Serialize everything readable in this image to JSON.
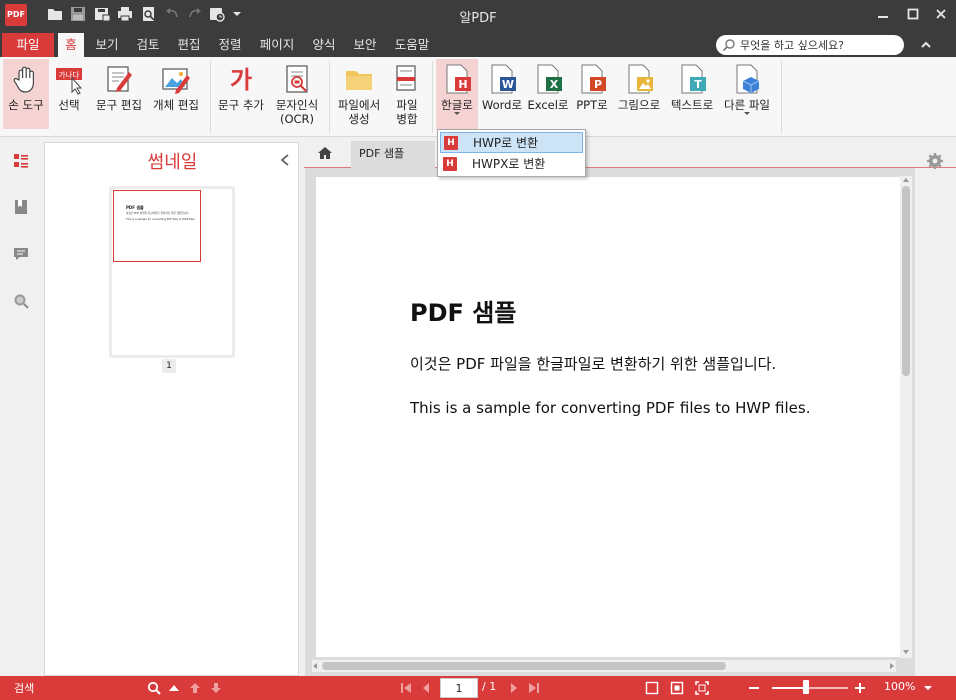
{
  "app": {
    "logo_text": "PDF",
    "title": "알PDF"
  },
  "menu": {
    "tabs": [
      {
        "label": "파일"
      },
      {
        "label": "홈"
      },
      {
        "label": "보기"
      },
      {
        "label": "검토"
      },
      {
        "label": "편집"
      },
      {
        "label": "정렬"
      },
      {
        "label": "페이지"
      },
      {
        "label": "양식"
      },
      {
        "label": "보안"
      },
      {
        "label": "도움말"
      }
    ],
    "active_tab": "홈"
  },
  "search": {
    "placeholder": "무엇을 하고 싶으세요?"
  },
  "ribbon": {
    "hand_tool": "손 도구",
    "select": "선택",
    "select_badge": "가나다",
    "text_edit": "문구 편집",
    "object_edit": "개체 편집",
    "add_text": "문구 추가",
    "add_text_glyph": "가",
    "ocr_line1": "문자인식",
    "ocr_line2": "(OCR)",
    "create_line1": "파일에서",
    "create_line2": "생성",
    "merge_line1": "파일",
    "merge_line2": "병합",
    "to_hangul": "한글로",
    "to_word": "Word로",
    "to_excel": "Excel로",
    "to_ppt": "PPT로",
    "to_image": "그림으로",
    "to_text": "텍스트로",
    "other_file": "다른 파일",
    "badge_h": "H",
    "badge_w": "W",
    "badge_x": "X",
    "badge_p": "P",
    "badge_t": "T"
  },
  "dropdown": {
    "items": [
      {
        "icon": "H",
        "label": "HWP로 변환"
      },
      {
        "icon": "H",
        "label": "HWPX로 변환"
      }
    ]
  },
  "thumbnail": {
    "title": "썸네일",
    "page_number": "1",
    "mini_title": "PDF 샘플",
    "mini_line1": "이것은 PDF 파일을 한글파일로 변환하기 위한 샘플입니다.",
    "mini_line2": "This is a sample for converting PDF files to HWP files."
  },
  "doc": {
    "tab_label": "PDF 샘플",
    "title": "PDF 샘플",
    "line1": "이것은 PDF 파일을 한글파일로 변환하기 위한 샘플입니다.",
    "line2": "This is a sample for converting PDF files to HWP files."
  },
  "status": {
    "search_label": "검색",
    "page_current": "1",
    "page_total": "/ 1",
    "zoom": "100%",
    "zoom_fraction": 0.45
  },
  "colors": {
    "accent": "#d93b3b",
    "titlebar": "#3c3c3c",
    "ribbon_bg": "#f7f7f7"
  }
}
